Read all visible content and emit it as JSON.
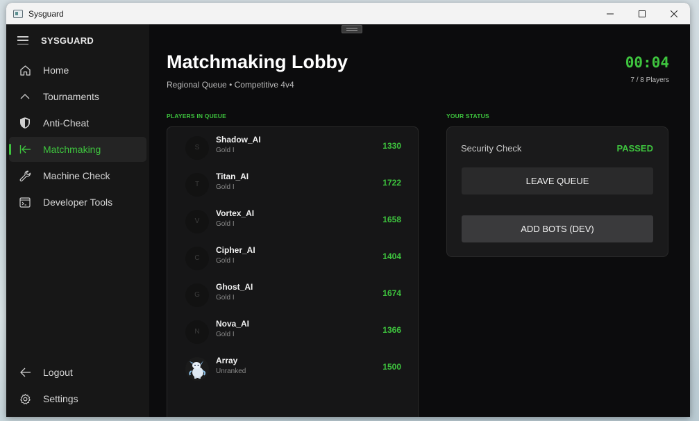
{
  "window": {
    "title": "Sysguard",
    "controls": [
      "minimize",
      "maximize",
      "close"
    ]
  },
  "sidebar": {
    "brand": "SYSGUARD",
    "items": [
      {
        "label": "Home",
        "icon": "home-icon"
      },
      {
        "label": "Tournaments",
        "icon": "chevron-up-icon"
      },
      {
        "label": "Anti-Cheat",
        "icon": "shield-icon"
      },
      {
        "label": "Matchmaking",
        "icon": "arrow-left-bar-icon",
        "active": true
      },
      {
        "label": "Machine Check",
        "icon": "wrench-icon"
      },
      {
        "label": "Developer Tools",
        "icon": "terminal-icon"
      }
    ],
    "bottom_items": [
      {
        "label": "Logout",
        "icon": "arrow-left-icon"
      },
      {
        "label": "Settings",
        "icon": "gear-icon"
      }
    ]
  },
  "header": {
    "title": "Matchmaking Lobby",
    "subtitle": "Regional Queue • Competitive 4v4",
    "timer": "00:04",
    "players_count": "7 / 8 Players"
  },
  "queue": {
    "label": "PLAYERS IN QUEUE",
    "players": [
      {
        "initial": "S",
        "name": "Shadow_AI",
        "rank": "Gold I",
        "score": "1330"
      },
      {
        "initial": "T",
        "name": "Titan_AI",
        "rank": "Gold I",
        "score": "1722"
      },
      {
        "initial": "V",
        "name": "Vortex_AI",
        "rank": "Gold I",
        "score": "1658"
      },
      {
        "initial": "C",
        "name": "Cipher_AI",
        "rank": "Gold I",
        "score": "1404"
      },
      {
        "initial": "G",
        "name": "Ghost_AI",
        "rank": "Gold I",
        "score": "1674"
      },
      {
        "initial": "N",
        "name": "Nova_AI",
        "rank": "Gold I",
        "score": "1366"
      },
      {
        "initial": "",
        "name": "Array",
        "rank": "Unranked",
        "score": "1500",
        "avatar_image": true
      }
    ]
  },
  "status": {
    "label": "YOUR STATUS",
    "security_label": "Security Check",
    "security_value": "PASSED",
    "leave_button": "LEAVE QUEUE",
    "bots_button": "ADD BOTS (DEV)"
  },
  "colors": {
    "accent": "#3ec43e",
    "background": "#0c0c0d",
    "sidebar": "#171717",
    "panel": "#161617"
  }
}
